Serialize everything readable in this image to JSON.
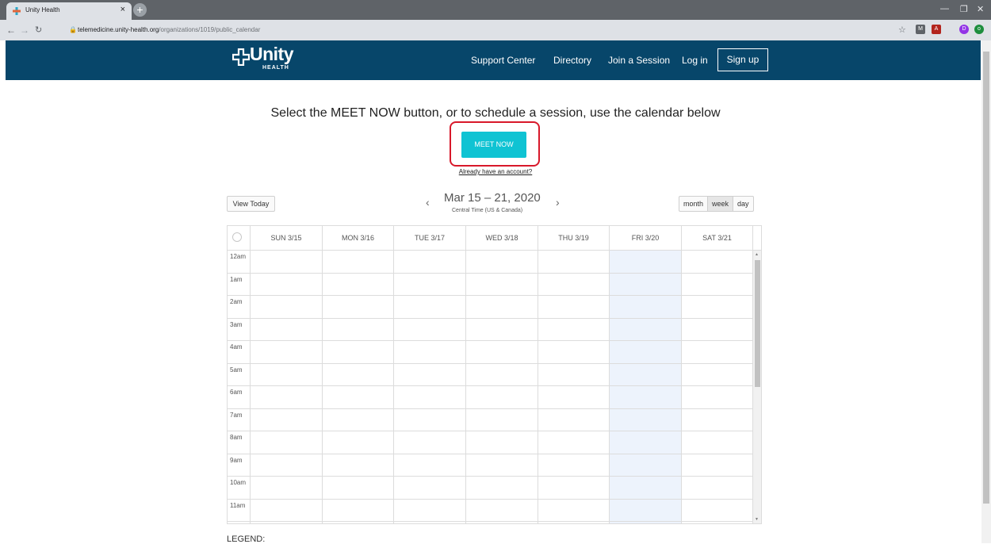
{
  "browser": {
    "tab_title": "Unity Health",
    "tab_close": "×",
    "new_tab": "+",
    "url_domain": "telemedicine.unity-health.org",
    "url_path": "/organizations/1019/public_calendar",
    "profile_initial": "D"
  },
  "site": {
    "logo_word": "Unity",
    "logo_sub": "HEALTH",
    "nav": [
      "Support Center",
      "Directory",
      "Join a Session",
      "Log in"
    ],
    "signup": "Sign up"
  },
  "main": {
    "headline": "Select the MEET NOW button, or to schedule a session, use the calendar below",
    "meet_now": "MEET NOW",
    "account_link": "Already have an account?"
  },
  "calendar": {
    "view_today": "View Today",
    "range": "Mar 15 – 21, 2020",
    "timezone": "Central Time (US & Canada)",
    "prev": "‹",
    "next": "›",
    "views": [
      "month",
      "week",
      "day"
    ],
    "active_view": "week",
    "days": [
      "SUN 3/15",
      "MON 3/16",
      "TUE 3/17",
      "WED 3/18",
      "THU 3/19",
      "FRI 3/20",
      "SAT 3/21"
    ],
    "today_index": 5,
    "hours": [
      "12am",
      "1am",
      "2am",
      "3am",
      "4am",
      "5am",
      "6am",
      "7am",
      "8am",
      "9am",
      "10am",
      "11am"
    ],
    "legend": "LEGEND:"
  },
  "colors": {
    "header_bg": "#07466a",
    "meet_btn": "#0fc3d3",
    "highlight": "#d8182a",
    "today_col": "#edf3fc"
  }
}
